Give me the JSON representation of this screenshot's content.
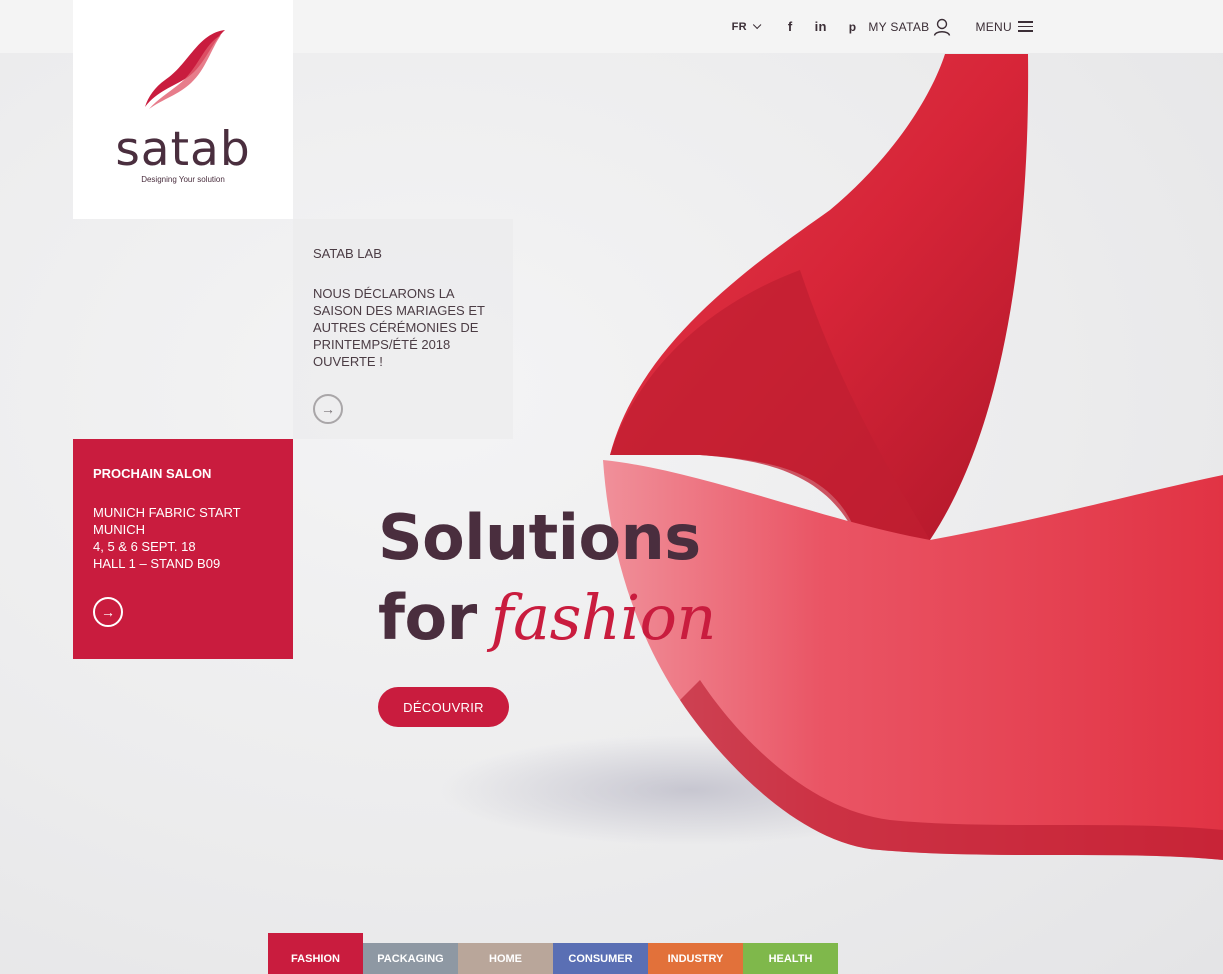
{
  "header": {
    "lang": "FR",
    "social": {
      "facebook": "f",
      "linkedin": "in",
      "pinterest": "p"
    },
    "account_label": "MY SATAB",
    "menu_label": "MENU"
  },
  "logo": {
    "wordmark": "satab",
    "tagline": "Designing Your solution",
    "swoosh_color": "#c91c3e"
  },
  "lab": {
    "title": "SATAB LAB",
    "text": "NOUS DÉCLARONS LA SAISON DES MARIAGES ET AUTRES CÉRÉMONIES DE PRINTEMPS/ÉTÉ 2018 OUVERTE !",
    "icon": "arrow-right-icon"
  },
  "salon": {
    "title": "PROCHAIN SALON",
    "lines": [
      "MUNICH FABRIC START",
      "MUNICH",
      "4, 5 & 6 SEPT. 18",
      "HALL 1 – STAND B09"
    ],
    "color": "#c91c3e",
    "icon": "arrow-right-icon"
  },
  "hero": {
    "line1": "Solutions",
    "line2_word": "for",
    "line2_script": "fashion",
    "cta": "DÉCOUVRIR"
  },
  "tabs": [
    {
      "label": "FASHION",
      "color": "#c91c3e",
      "active": true
    },
    {
      "label": "PACKAGING",
      "color": "#8e98a3",
      "active": false
    },
    {
      "label": "HOME",
      "color": "#b9a69a",
      "active": false
    },
    {
      "label": "CONSUMER",
      "color": "#5a6fb4",
      "active": false
    },
    {
      "label": "INDUSTRY",
      "color": "#e2713a",
      "active": false
    },
    {
      "label": "HEALTH",
      "color": "#7fb84b",
      "active": false
    }
  ]
}
